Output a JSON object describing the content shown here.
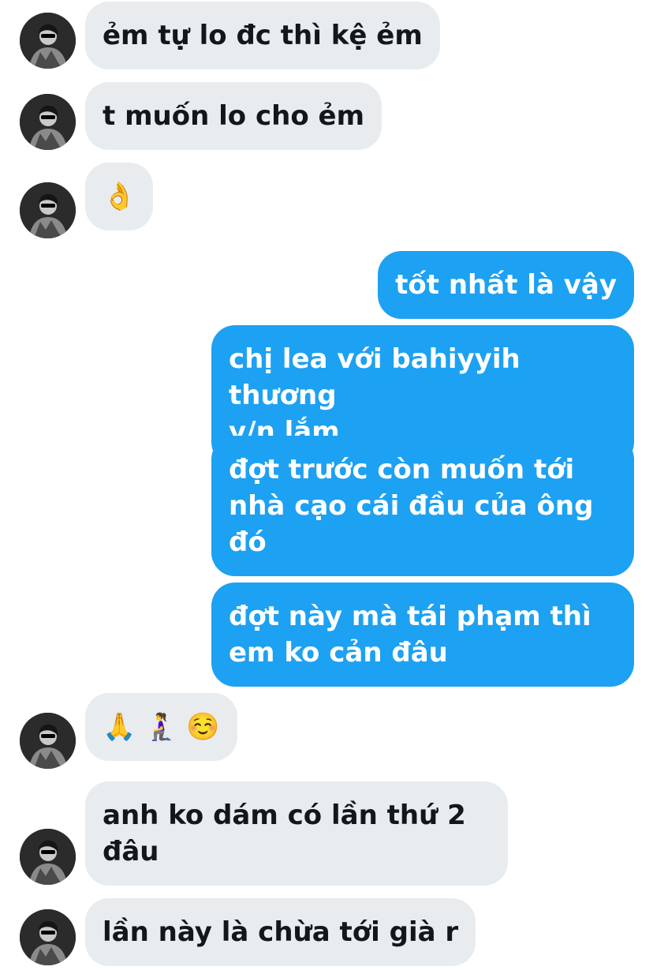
{
  "messages": [
    {
      "side": "in",
      "text": "ẻm tự lo đc thì kệ ẻm",
      "avatar": true
    },
    {
      "side": "in",
      "text": "t muốn lo cho ẻm",
      "avatar": true
    },
    {
      "side": "in",
      "text": "👌",
      "avatar": true
    },
    {
      "side": "out",
      "text": "tốt nhất là vậy"
    },
    {
      "side": "out",
      "text": "chị lea với bahiyyih thương\ny/n lắm"
    },
    {
      "side": "out",
      "text": "đợt trước còn muốn tới\nnhà cạo cái đầu của ông\nđó"
    },
    {
      "side": "out",
      "text": "đợt này mà tái phạm thì\nem ko cản đâu"
    },
    {
      "side": "in",
      "text": "🙏 🧎‍♀️ ☺️",
      "avatar": true
    },
    {
      "side": "in",
      "text": "anh ko dám có lần thứ 2\nđâu",
      "avatar": true
    },
    {
      "side": "in",
      "text": "lần này là chừa tới già r",
      "avatar": true
    }
  ],
  "colors": {
    "incoming_bubble": "#e8ecef",
    "outgoing_bubble": "#1da1f2",
    "incoming_text": "#14171a",
    "outgoing_text": "#ffffff"
  },
  "icons": {
    "avatar": "profile-photo"
  }
}
